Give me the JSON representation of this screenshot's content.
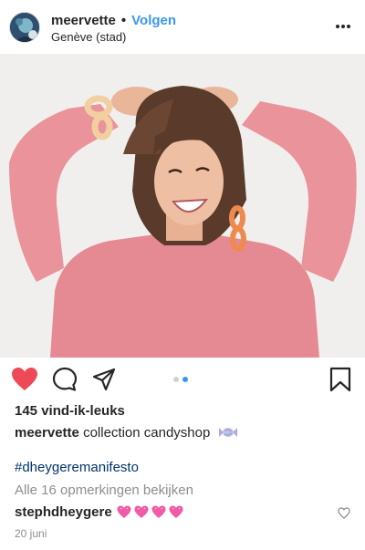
{
  "post": {
    "username": "meervette",
    "separator": "•",
    "follow_label": "Volgen",
    "location": "Genève (stad)",
    "more_icon": "more-horizontal-icon"
  },
  "actions": {
    "like_icon": "heart-filled-icon",
    "comment_icon": "comment-icon",
    "share_icon": "paper-plane-icon",
    "save_icon": "bookmark-icon",
    "liked_color": "#ed4956",
    "carousel": {
      "count": 2,
      "active_index": 1
    }
  },
  "likes_text": "145 vind-ik-leuks",
  "caption": {
    "username": "meervette",
    "text": "collection candyshop",
    "emoji_icon": "candy-icon"
  },
  "hashtag": "#dheygeremanifesto",
  "view_comments": "Alle 16 opmerkingen bekijken",
  "comment": {
    "username": "stephdheygere",
    "emoji_icon": "heart-emoji-icon",
    "emoji_count": 4,
    "like_icon": "heart-outline-icon"
  },
  "date": "20 juni",
  "colors": {
    "accent": "#3897f0",
    "hashtag": "#003569",
    "muted": "#8e8e8e",
    "emoji_pink": "#f05aa6"
  }
}
